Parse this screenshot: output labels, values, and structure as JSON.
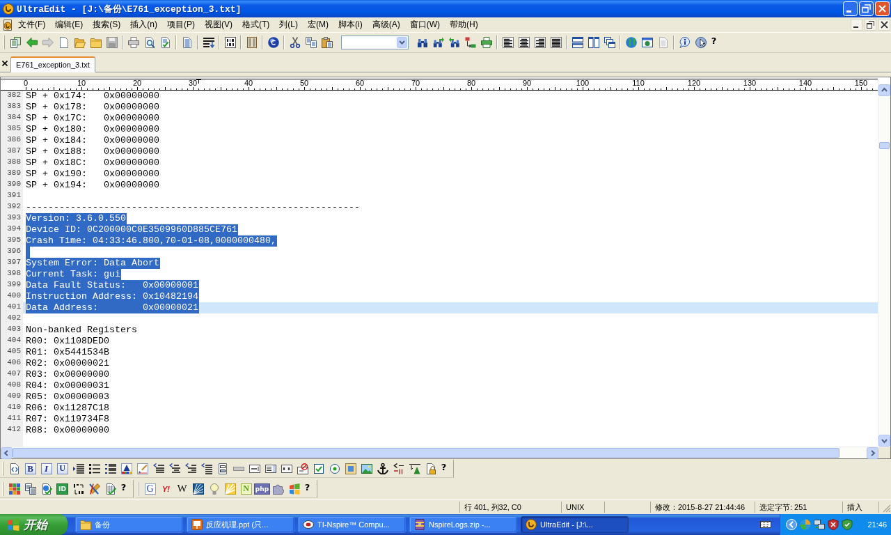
{
  "window": {
    "title": "UltraEdit - [J:\\备份\\E761_exception_3.txt]"
  },
  "menu": [
    "文件(F)",
    "编辑(E)",
    "搜索(S)",
    "插入(n)",
    "项目(P)",
    "视图(V)",
    "格式(T)",
    "列(L)",
    "宏(M)",
    "脚本(i)",
    "高级(A)",
    "窗口(W)",
    "帮助(H)"
  ],
  "main_toolbar": {
    "help_label": "?"
  },
  "tabs": [
    {
      "label": "E761_exception_3.txt",
      "selected": true
    }
  ],
  "ruler": {
    "labels": [
      "0",
      "10",
      "20",
      "30",
      "40",
      "50",
      "60",
      "70",
      "80",
      "90",
      "100",
      "110",
      "120",
      "130",
      "140",
      "150"
    ]
  },
  "editor": {
    "lines": [
      {
        "number": "382",
        "text": "SP + 0x174:   0x00000000",
        "selected": false,
        "current": false
      },
      {
        "number": "383",
        "text": "SP + 0x178:   0x00000000",
        "selected": false,
        "current": false
      },
      {
        "number": "384",
        "text": "SP + 0x17C:   0x00000000",
        "selected": false,
        "current": false
      },
      {
        "number": "385",
        "text": "SP + 0x180:   0x00000000",
        "selected": false,
        "current": false
      },
      {
        "number": "386",
        "text": "SP + 0x184:   0x00000000",
        "selected": false,
        "current": false
      },
      {
        "number": "387",
        "text": "SP + 0x188:   0x00000000",
        "selected": false,
        "current": false
      },
      {
        "number": "388",
        "text": "SP + 0x18C:   0x00000000",
        "selected": false,
        "current": false
      },
      {
        "number": "389",
        "text": "SP + 0x190:   0x00000000",
        "selected": false,
        "current": false
      },
      {
        "number": "390",
        "text": "SP + 0x194:   0x00000000",
        "selected": false,
        "current": false
      },
      {
        "number": "391",
        "selected": false,
        "current": false
      },
      {
        "number": "392",
        "text": "------------------------------------------------------------",
        "selected": false,
        "current": false
      },
      {
        "number": "393",
        "text": "Version: 3.6.0.550",
        "selected": true,
        "current": false
      },
      {
        "number": "394",
        "text": "Device ID: 0C200000C0E3509960D885CE761",
        "selected": true,
        "current": false
      },
      {
        "number": "395",
        "text": "Crash Time: 04:33:46.800,70-01-08,0000000480,",
        "selected": true,
        "current": false
      },
      {
        "number": "396",
        "selected": true,
        "current": false
      },
      {
        "number": "397",
        "text": "System Error: Data Abort",
        "selected": true,
        "current": false
      },
      {
        "number": "398",
        "text": "Current Task: gui",
        "selected": true,
        "current": false
      },
      {
        "number": "399",
        "text": "Data Fault Status:   0x00000001",
        "selected": true,
        "current": false
      },
      {
        "number": "400",
        "text": "Instruction Address: 0x10482194",
        "selected": true,
        "current": false
      },
      {
        "number": "401",
        "text": "Data Address:        0x00000021",
        "selected": true,
        "current": true
      },
      {
        "number": "402",
        "selected": false,
        "current": false
      },
      {
        "number": "403",
        "text": "Non-banked Registers",
        "selected": false,
        "current": false
      },
      {
        "number": "404",
        "text": "R00: 0x1108DED0",
        "selected": false,
        "current": false
      },
      {
        "number": "405",
        "text": "R01: 0x5441534B",
        "selected": false,
        "current": false
      },
      {
        "number": "406",
        "text": "R02: 0x00000021",
        "selected": false,
        "current": false
      },
      {
        "number": "407",
        "text": "R03: 0x00000000",
        "selected": false,
        "current": false
      },
      {
        "number": "408",
        "text": "R04: 0x00000031",
        "selected": false,
        "current": false
      },
      {
        "number": "409",
        "text": "R05: 0x00000003",
        "selected": false,
        "current": false
      },
      {
        "number": "410",
        "text": "R06: 0x11287C18",
        "selected": false,
        "current": false
      },
      {
        "number": "411",
        "text": "R07: 0x119734F8",
        "selected": false,
        "current": false
      },
      {
        "number": "412",
        "text": "R08: 0x00000000",
        "selected": false,
        "current": false
      }
    ]
  },
  "format_toolbar": {
    "letter_buttons": [
      "B",
      "I",
      "U"
    ],
    "help_label": "?"
  },
  "tools_toolbar": {
    "letter_buttons": [
      "ID"
    ],
    "help_label": "?"
  },
  "web_toolbar": {
    "letter_buttons": [
      "G",
      "Y!",
      "W",
      "N",
      "php"
    ],
    "help_label": "?"
  },
  "status_bar": {
    "position": "行 401, 列32, C0",
    "line_ending": "UNIX",
    "modified": "修改：2015-8-27 21:44:46",
    "selection": "选定字节: 251",
    "mode": "插入"
  },
  "taskbar": {
    "start_label": "开始",
    "tasks": [
      {
        "label": "备份",
        "selected": false
      },
      {
        "label": "反应机理.ppt (只...",
        "selected": false
      },
      {
        "label": "TI-Nspire™ Compu...",
        "selected": false
      },
      {
        "label": "NspireLogs.zip -...",
        "selected": false
      },
      {
        "label": "UltraEdit - [J:\\...",
        "selected": true
      }
    ],
    "clock": "21:46"
  }
}
